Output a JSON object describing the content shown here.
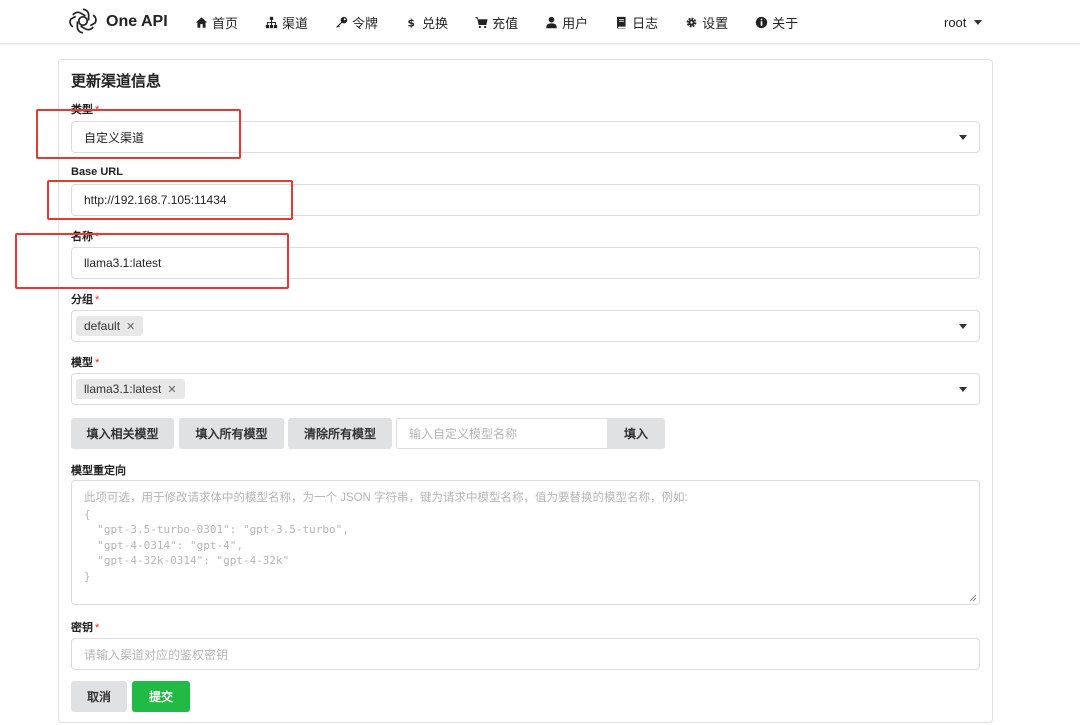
{
  "nav": {
    "brand": "One API",
    "items": [
      {
        "label": "首页",
        "icon": "home-icon"
      },
      {
        "label": "渠道",
        "icon": "sitemap-icon"
      },
      {
        "label": "令牌",
        "icon": "key-icon"
      },
      {
        "label": "兑换",
        "icon": "dollar-icon"
      },
      {
        "label": "充值",
        "icon": "cart-icon"
      },
      {
        "label": "用户",
        "icon": "user-icon"
      },
      {
        "label": "日志",
        "icon": "book-icon"
      },
      {
        "label": "设置",
        "icon": "gear-icon"
      },
      {
        "label": "关于",
        "icon": "info-icon"
      }
    ],
    "user": "root"
  },
  "form": {
    "title": "更新渠道信息",
    "type": {
      "label": "类型",
      "value": "自定义渠道"
    },
    "base_url": {
      "label": "Base URL",
      "value": "http://192.168.7.105:11434"
    },
    "name": {
      "label": "名称",
      "value": "llama3.1:latest"
    },
    "group": {
      "label": "分组",
      "chip": "default"
    },
    "models": {
      "label": "模型",
      "chip": "llama3.1:latest"
    },
    "buttons": {
      "fill_related": "填入相关模型",
      "fill_all": "填入所有模型",
      "clear_all": "清除所有模型",
      "custom_placeholder": "输入自定义模型名称",
      "fill": "填入"
    },
    "model_mapping": {
      "label": "模型重定向",
      "placeholder_lines": [
        "此项可选，用于修改请求体中的模型名称，为一个 JSON 字符串，键为请求中模型名称，值为要替换的模型名称，例如:",
        "{",
        "  \"gpt-3.5-turbo-0301\": \"gpt-3.5-turbo\",",
        "  \"gpt-4-0314\": \"gpt-4\",",
        "  \"gpt-4-32k-0314\": \"gpt-4-32k\"",
        "}"
      ]
    },
    "key": {
      "label": "密钥",
      "placeholder": "请输入渠道对应的鉴权密钥"
    },
    "cancel": "取消",
    "submit": "提交"
  },
  "colors": {
    "accent_green": "#21ba45",
    "required_red": "#db2828",
    "annotation_red": "#e53935"
  }
}
